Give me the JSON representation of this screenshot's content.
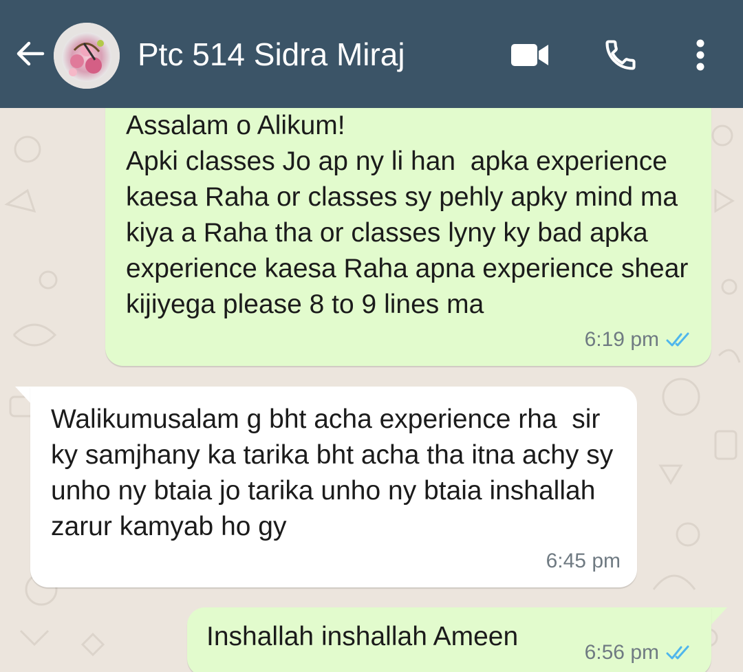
{
  "header": {
    "contact_name": "Ptc 514 Sidra Miraj",
    "back_icon": "arrow-left-icon",
    "video_icon": "video-camera-icon",
    "call_icon": "phone-icon",
    "menu_icon": "more-vertical-icon",
    "background_color": "#3b5467"
  },
  "messages": [
    {
      "direction": "outgoing",
      "text": "Assalam o Alikum!\nApki classes Jo ap ny li han  apka experience kaesa Raha or classes sy pehly apky mind ma kiya a Raha tha or classes lyny ky bad apka experience kaesa Raha apna experience shear kijiyega please 8 to 9 lines ma",
      "time": "6:19 pm",
      "status": "read"
    },
    {
      "direction": "incoming",
      "text": "Walikumusalam g bht acha experience rha  sir ky samjhany ka tarika bht acha tha itna achy sy unho ny btaia jo tarika unho ny btaia inshallah zarur kamyab ho gy",
      "time": "6:45 pm"
    },
    {
      "direction": "outgoing",
      "text": "Inshallah inshallah Ameen",
      "time": "6:56 pm",
      "status": "read"
    }
  ],
  "colors": {
    "outgoing_bubble": "#e2fbcd",
    "incoming_bubble": "#ffffff",
    "chat_background": "#ece5dd",
    "read_ticks": "#4fb6ec"
  }
}
